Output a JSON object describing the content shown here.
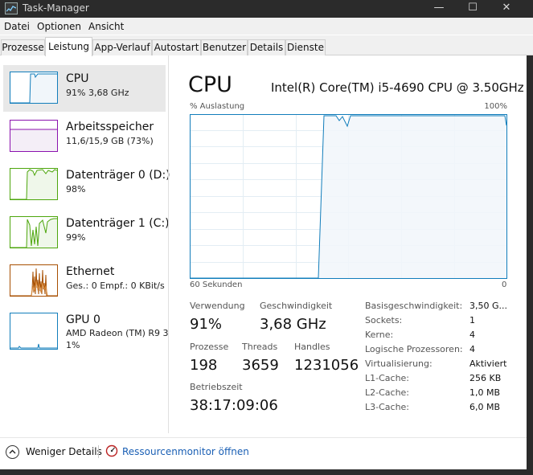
{
  "window": {
    "title": "Task-Manager",
    "app_icon": "task-manager-icon"
  },
  "menu": [
    "Datei",
    "Optionen",
    "Ansicht"
  ],
  "tabs": [
    {
      "label": "Prozesse",
      "active": false
    },
    {
      "label": "Leistung",
      "active": true
    },
    {
      "label": "App-Verlauf",
      "active": false
    },
    {
      "label": "Autostart",
      "active": false
    },
    {
      "label": "Benutzer",
      "active": false
    },
    {
      "label": "Details",
      "active": false
    },
    {
      "label": "Dienste",
      "active": false
    }
  ],
  "sidebar": {
    "items": [
      {
        "title": "CPU",
        "sub": "91% 3,68 GHz",
        "selected": true,
        "color": "#117dbb"
      },
      {
        "title": "Arbeitsspeicher",
        "sub": "11,6/15,9 GB (73%)",
        "selected": false,
        "color": "#8b12ae"
      },
      {
        "title": "Datenträger 0 (D:)",
        "sub": "98%",
        "selected": false,
        "color": "#4da60c"
      },
      {
        "title": "Datenträger 1 (C:)",
        "sub": "99%",
        "selected": false,
        "color": "#4da60c"
      },
      {
        "title": "Ethernet",
        "sub": "Ges.: 0 Empf.: 0 KBit/s",
        "selected": false,
        "color": "#a74f01"
      },
      {
        "title": "GPU 0",
        "sub": "AMD Radeon (TM) R9 39",
        "sub2": "1%",
        "selected": false,
        "color": "#117dbb"
      }
    ]
  },
  "main": {
    "title": "CPU",
    "model": "Intel(R) Core(TM) i5-4690 CPU @ 3.50GHz",
    "graph": {
      "ylabel": "% Auslastung",
      "ymax": "100%",
      "xlabel": "60 Sekunden",
      "xmin": "0",
      "line_color": "#117dbb",
      "fill_color": "#f1f6fa"
    },
    "stats": {
      "verwendung_label": "Verwendung",
      "verwendung_value": "91%",
      "geschwindigkeit_label": "Geschwindigkeit",
      "geschwindigkeit_value": "3,68 GHz",
      "prozesse_label": "Prozesse",
      "prozesse_value": "198",
      "threads_label": "Threads",
      "threads_value": "3659",
      "handles_label": "Handles",
      "handles_value": "1231056",
      "betriebszeit_label": "Betriebszeit",
      "betriebszeit_value": "38:17:09:06"
    },
    "info": [
      {
        "label": "Basisgeschwindigkeit:",
        "value": "3,50 G..."
      },
      {
        "label": "Sockets:",
        "value": "1"
      },
      {
        "label": "Kerne:",
        "value": "4"
      },
      {
        "label": "Logische Prozessoren:",
        "value": "4"
      },
      {
        "label": "Virtualisierung:",
        "value": "Aktiviert"
      },
      {
        "label": "L1-Cache:",
        "value": "256 KB"
      },
      {
        "label": "L2-Cache:",
        "value": "1,0 MB"
      },
      {
        "label": "L3-Cache:",
        "value": "6,0 MB"
      }
    ]
  },
  "footer": {
    "less_details": "Weniger Details",
    "resource_monitor": "Ressourcenmonitor öffnen"
  }
}
